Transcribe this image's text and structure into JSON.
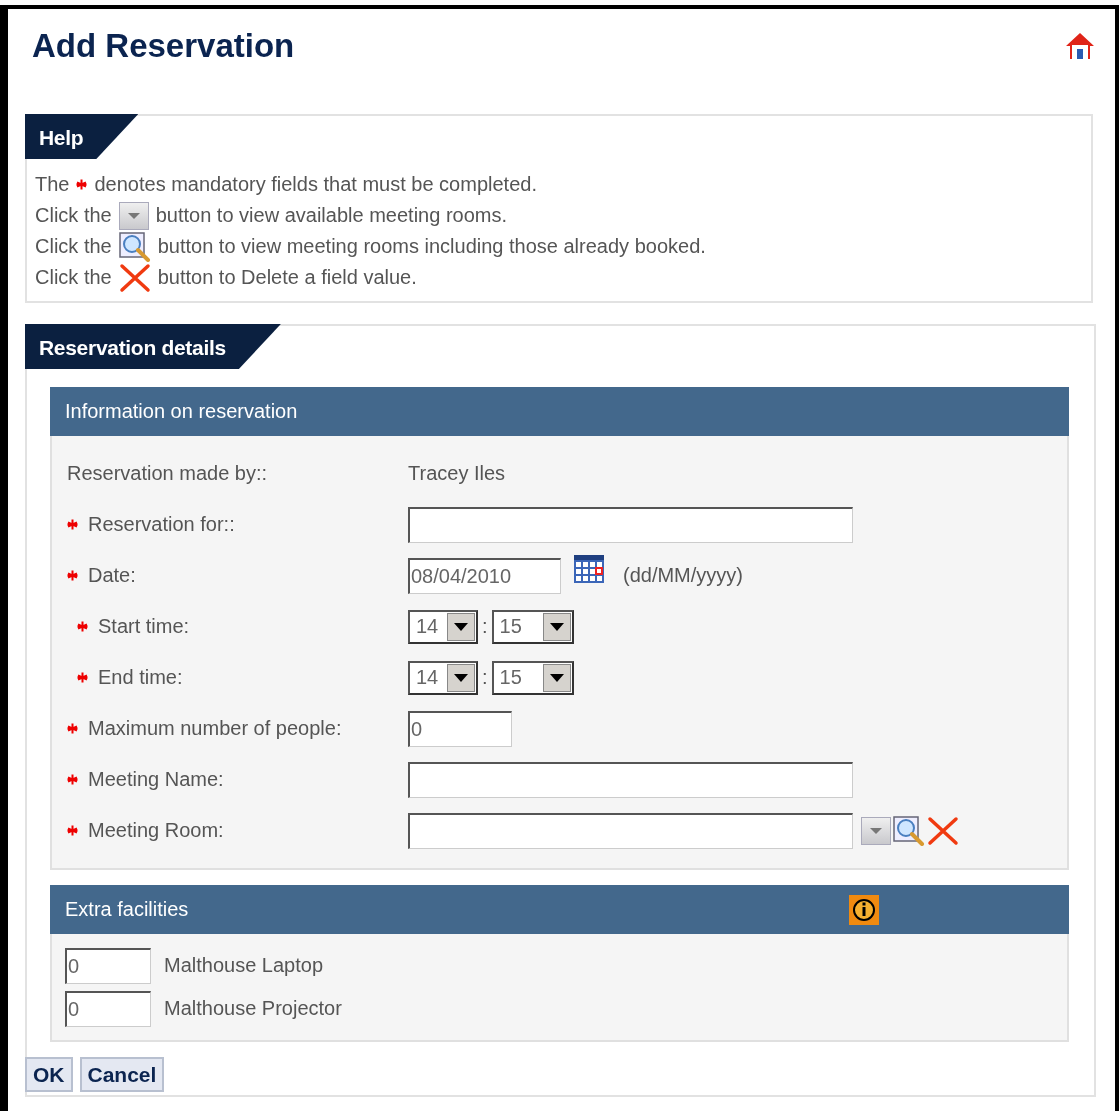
{
  "title": "Add Reservation",
  "help": {
    "title": "Help",
    "lines": [
      {
        "lead": "The",
        "text": "denotes mandatory fields that must be completed."
      },
      {
        "lead": "Click the",
        "text": "button to view available meeting rooms."
      },
      {
        "lead": "Click the",
        "text": "button to view meeting rooms including those already booked."
      },
      {
        "lead": "Click the",
        "text": "button to Delete a field value."
      }
    ]
  },
  "details": {
    "title": "Reservation details",
    "info": {
      "title": "Information on reservation",
      "rows": [
        {
          "kind": "text",
          "required": false,
          "label": "Reservation made by::",
          "value": "Tracey Iles"
        },
        {
          "kind": "long",
          "required": true,
          "label": "Reservation for::"
        },
        {
          "kind": "date",
          "required": true,
          "label": "Date:",
          "value": "08/04/2010",
          "hint": "(dd/MM/yyyy)"
        },
        {
          "kind": "time",
          "required": true,
          "label": "Start time:",
          "hour": "14",
          "separator": ":",
          "minute": "15"
        },
        {
          "kind": "time",
          "required": true,
          "label": "End time:",
          "hour": "14",
          "separator": ":",
          "minute": "15"
        },
        {
          "kind": "number",
          "required": true,
          "label": "Maximum number of people:",
          "value": "0"
        },
        {
          "kind": "long",
          "required": true,
          "label": "Meeting Name:"
        },
        {
          "kind": "room",
          "required": true,
          "label": "Meeting Room:"
        }
      ]
    },
    "extras": {
      "title": "Extra facilities",
      "items": [
        {
          "value": "0",
          "label": "Malthouse Laptop"
        },
        {
          "value": "0",
          "label": "Malthouse Projector"
        }
      ]
    },
    "buttons": [
      "OK",
      "Cancel"
    ]
  }
}
